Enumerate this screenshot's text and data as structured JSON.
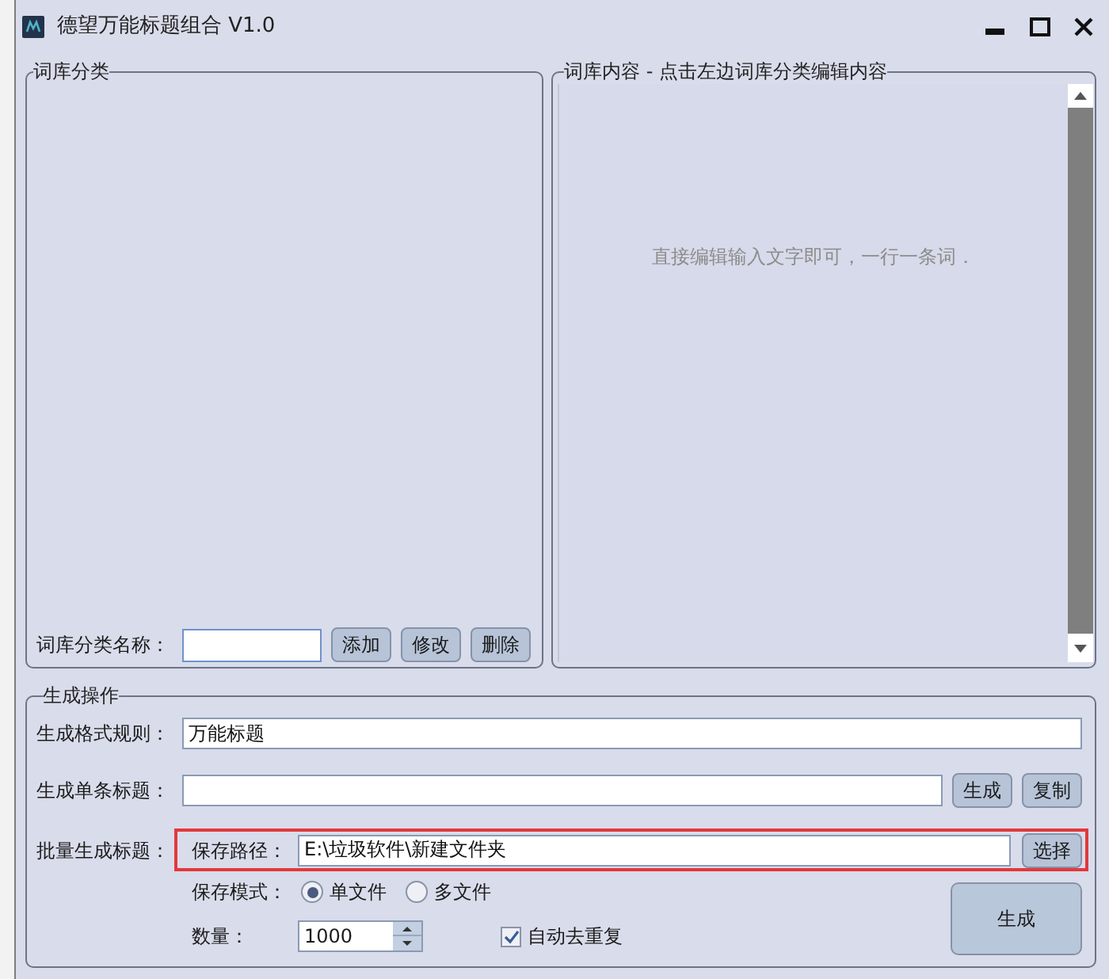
{
  "window": {
    "title": "德望万能标题组合 V1.0"
  },
  "category_panel": {
    "title": "词库分类",
    "name_label": "词库分类名称：",
    "buttons": [
      "添加",
      "修改",
      "删除"
    ]
  },
  "content_panel": {
    "title": "词库内容 - 点击左边词库分类编辑内容",
    "placeholder": "直接编辑输入文字即可，一行一条词．"
  },
  "generate_panel": {
    "title": "生成操作",
    "format_rule": {
      "label": "生成格式规则：",
      "value": "万能标题"
    },
    "single_title": {
      "label": "生成单条标题：",
      "buttons": [
        "生成",
        "复制"
      ]
    },
    "batch": {
      "label": "批量生成标题：",
      "save_path": {
        "label": "保存路径：",
        "value": "E:\\垃圾软件\\新建文件夹",
        "button": "选择"
      },
      "save_mode": {
        "label": "保存模式：",
        "options": [
          {
            "label": "单文件",
            "selected": true
          },
          {
            "label": "多文件",
            "selected": false
          }
        ]
      },
      "count": {
        "label": "数量：",
        "value": "1000"
      },
      "dedupe": {
        "label": "自动去重复",
        "checked": true
      },
      "generate_button": "生成"
    }
  }
}
